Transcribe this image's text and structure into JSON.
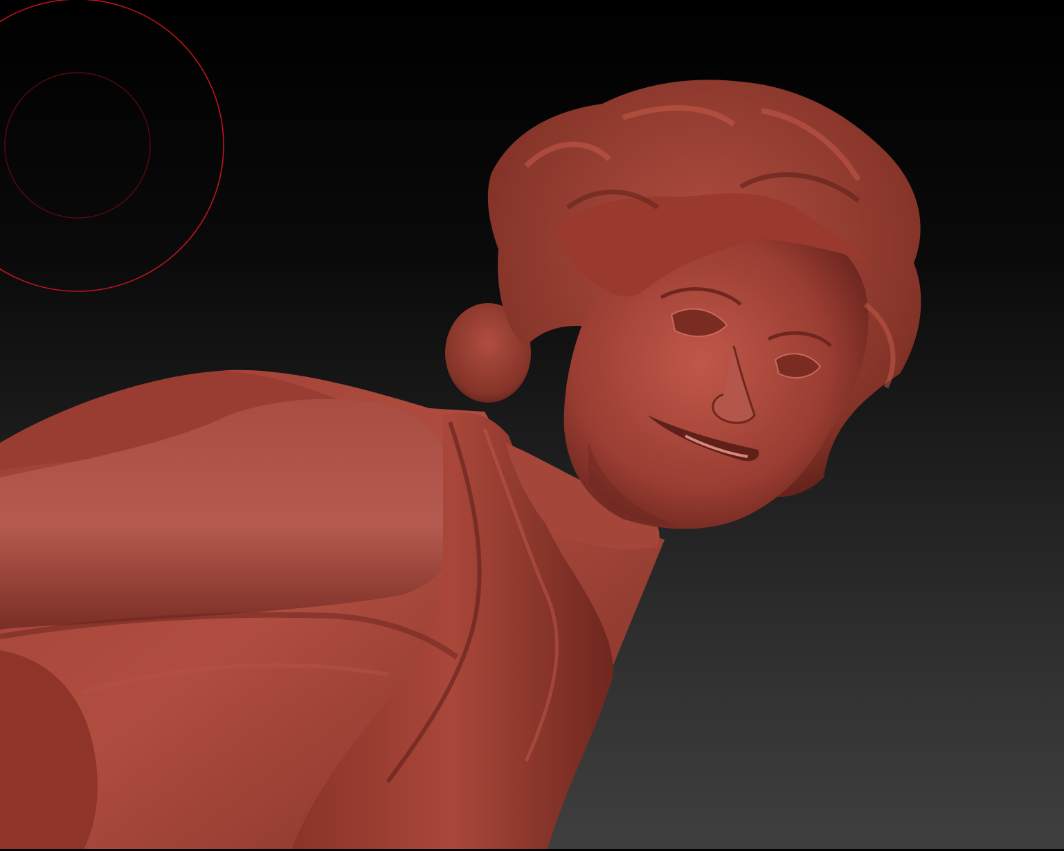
{
  "viewport": {
    "background_top": "#000000",
    "background_bottom": "#3f3f3f",
    "model_color": "#a8453a",
    "model_highlight": "#c35a4c",
    "model_shadow": "#5e2019",
    "brush_cursor_color": "#c0141c"
  },
  "brush_cursor": {
    "icon": "brush-circle-cursor"
  },
  "model": {
    "icon": "sculpted-figure-mesh"
  }
}
